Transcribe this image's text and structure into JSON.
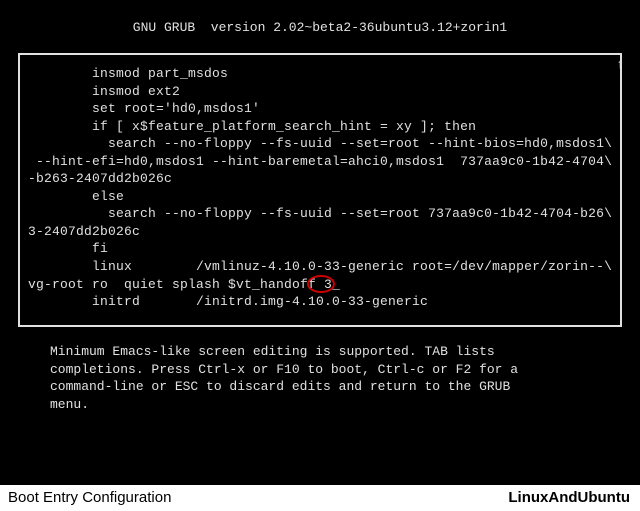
{
  "header": "GNU GRUB  version 2.02~beta2-36ubuntu3.12+zorin1",
  "scroll_indicator": "↑",
  "editor_lines": [
    "        insmod part_msdos",
    "        insmod ext2",
    "        set root='hd0,msdos1'",
    "        if [ x$feature_platform_search_hint = xy ]; then",
    "          search --no-floppy --fs-uuid --set=root --hint-bios=hd0,msdos1\\",
    " --hint-efi=hd0,msdos1 --hint-baremetal=ahci0,msdos1  737aa9c0-1b42-4704\\",
    "-b263-2407dd2b026c",
    "        else",
    "          search --no-floppy --fs-uuid --set=root 737aa9c0-1b42-4704-b26\\",
    "3-2407dd2b026c",
    "        fi",
    "        linux        /vmlinuz-4.10.0-33-generic root=/dev/mapper/zorin--\\",
    "vg-root ro  quiet splash $vt_handoff 3_",
    "        initrd       /initrd.img-4.10.0-33-generic"
  ],
  "highlight_value": "3",
  "help_text": "Minimum Emacs-like screen editing is supported. TAB lists\ncompletions. Press Ctrl-x or F10 to boot, Ctrl-c or F2 for a\ncommand-line or ESC to discard edits and return to the GRUB\nmenu.",
  "footer_left": "Boot Entry Configuration",
  "footer_right": "LinuxAndUbuntu"
}
